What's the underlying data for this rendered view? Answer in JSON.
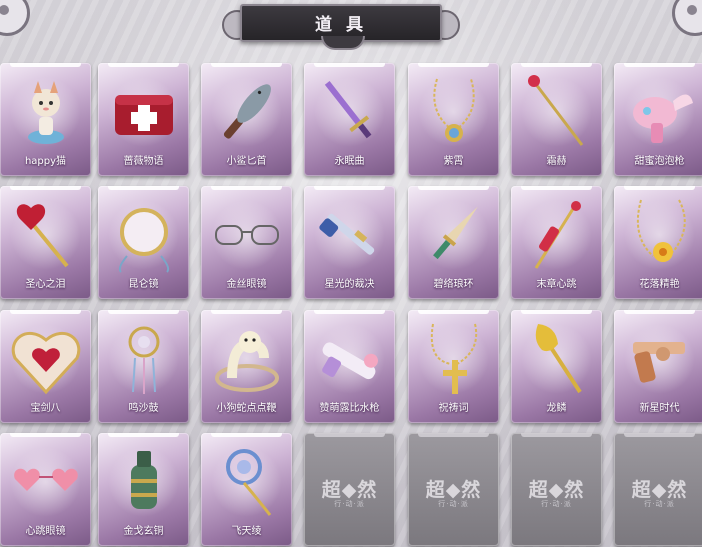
{
  "header": {
    "title": "道 具"
  },
  "items": [
    {
      "label": "happy猫",
      "icon": "cat-figurine-icon"
    },
    {
      "label": "蔷薇物语",
      "icon": "medical-case-icon"
    },
    {
      "label": "小鲨匕首",
      "icon": "shark-dagger-icon"
    },
    {
      "label": "永眠曲",
      "icon": "purple-sword-icon"
    },
    {
      "label": "紫霄",
      "icon": "pendant-necklace-icon"
    },
    {
      "label": "霜赫",
      "icon": "red-staff-icon"
    },
    {
      "label": "甜蜜泡泡枪",
      "icon": "bubble-gun-icon"
    },
    {
      "label": "圣心之泪",
      "icon": "heart-key-icon"
    },
    {
      "label": "昆仑镜",
      "icon": "ornate-mirror-icon"
    },
    {
      "label": "金丝眼镜",
      "icon": "glasses-icon"
    },
    {
      "label": "星光的裁决",
      "icon": "rifle-icon"
    },
    {
      "label": "碧络琅环",
      "icon": "jade-dagger-icon"
    },
    {
      "label": "末章心跳",
      "icon": "scepter-icon"
    },
    {
      "label": "花落精艳",
      "icon": "flower-necklace-icon"
    },
    {
      "label": "宝剑八",
      "icon": "heart-shield-icon"
    },
    {
      "label": "鸣沙鼓",
      "icon": "dreamcatcher-icon"
    },
    {
      "label": "小狗蛇点点鞭",
      "icon": "snake-whip-icon"
    },
    {
      "label": "赞萌露比水枪",
      "icon": "water-gun-icon"
    },
    {
      "label": "祝祷词",
      "icon": "cross-necklace-icon"
    },
    {
      "label": "龙鳞",
      "icon": "golden-shovel-icon"
    },
    {
      "label": "新星时代",
      "icon": "revolver-icon"
    },
    {
      "label": "心跳眼镜",
      "icon": "heart-glasses-icon"
    },
    {
      "label": "金戈玄铜",
      "icon": "bronze-grenade-icon"
    },
    {
      "label": "飞天绫",
      "icon": "ribbon-flower-icon"
    }
  ],
  "empty_slot": {
    "logo": "超◆然",
    "sub": "行·动·派"
  }
}
